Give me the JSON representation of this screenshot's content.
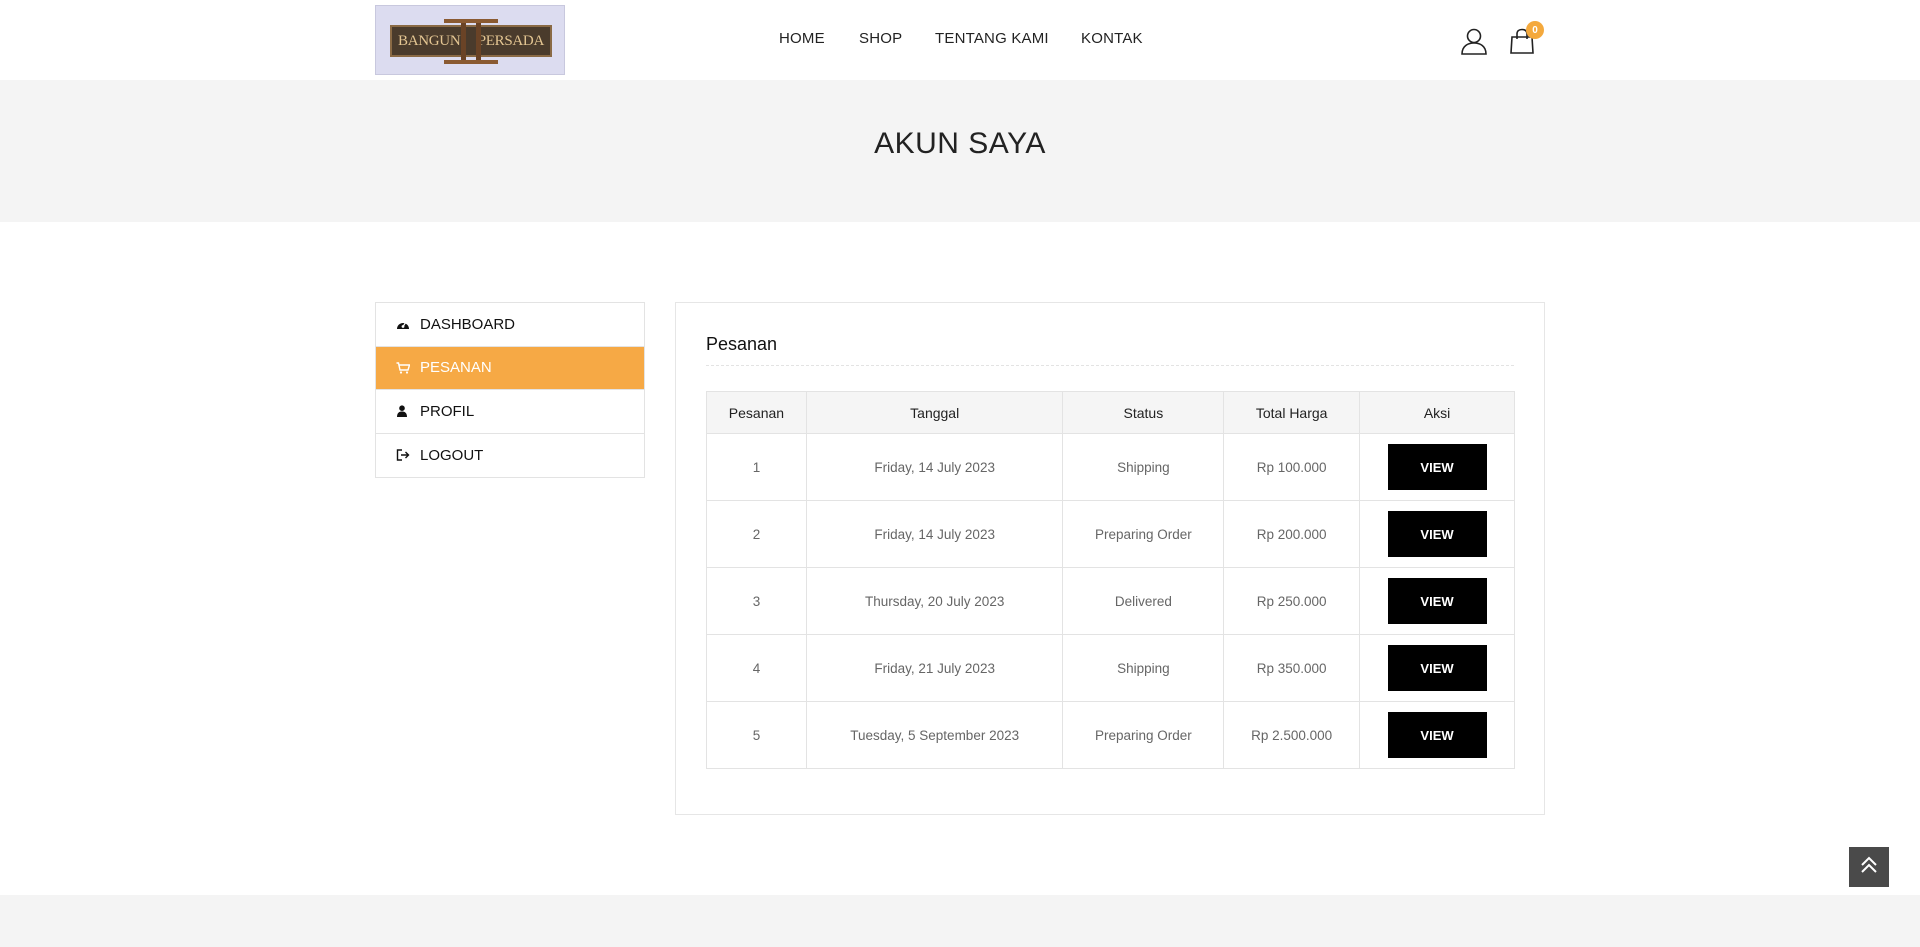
{
  "brand": {
    "logo_text_left": "BANGUN",
    "logo_text_right": "PERSADA",
    "colors": {
      "accent": "#f6a945",
      "badge": "#f4a93d",
      "button": "#000000",
      "banner_bg": "#f4f4f4"
    }
  },
  "nav": {
    "items": [
      {
        "label": "HOME"
      },
      {
        "label": "SHOP"
      },
      {
        "label": "TENTANG KAMI"
      },
      {
        "label": "KONTAK"
      }
    ],
    "user_icon": "user-icon",
    "cart_icon": "shopping-bag-icon",
    "cart_count": "0"
  },
  "banner": {
    "title": "AKUN SAYA"
  },
  "sidebar": {
    "items": [
      {
        "label": "DASHBOARD",
        "icon": "dashboard-icon"
      },
      {
        "label": "PESANAN",
        "icon": "cart-icon",
        "active": true
      },
      {
        "label": "PROFIL",
        "icon": "user-icon"
      },
      {
        "label": "LOGOUT",
        "icon": "logout-icon"
      }
    ]
  },
  "orders": {
    "title": "Pesanan",
    "columns": [
      "Pesanan",
      "Tanggal",
      "Status",
      "Total Harga",
      "Aksi"
    ],
    "rows": [
      {
        "id": "1",
        "date": "Friday, 14 July 2023",
        "status": "Shipping",
        "total": "Rp 100.000",
        "action": "VIEW"
      },
      {
        "id": "2",
        "date": "Friday, 14 July 2023",
        "status": "Preparing Order",
        "total": "Rp 200.000",
        "action": "VIEW"
      },
      {
        "id": "3",
        "date": "Thursday, 20 July 2023",
        "status": "Delivered",
        "total": "Rp 250.000",
        "action": "VIEW"
      },
      {
        "id": "4",
        "date": "Friday, 21 July 2023",
        "status": "Shipping",
        "total": "Rp 350.000",
        "action": "VIEW"
      },
      {
        "id": "5",
        "date": "Tuesday, 5 September 2023",
        "status": "Preparing Order",
        "total": "Rp 2.500.000",
        "action": "VIEW"
      }
    ]
  },
  "scroll_top_icon": "double-chevron-up-icon"
}
